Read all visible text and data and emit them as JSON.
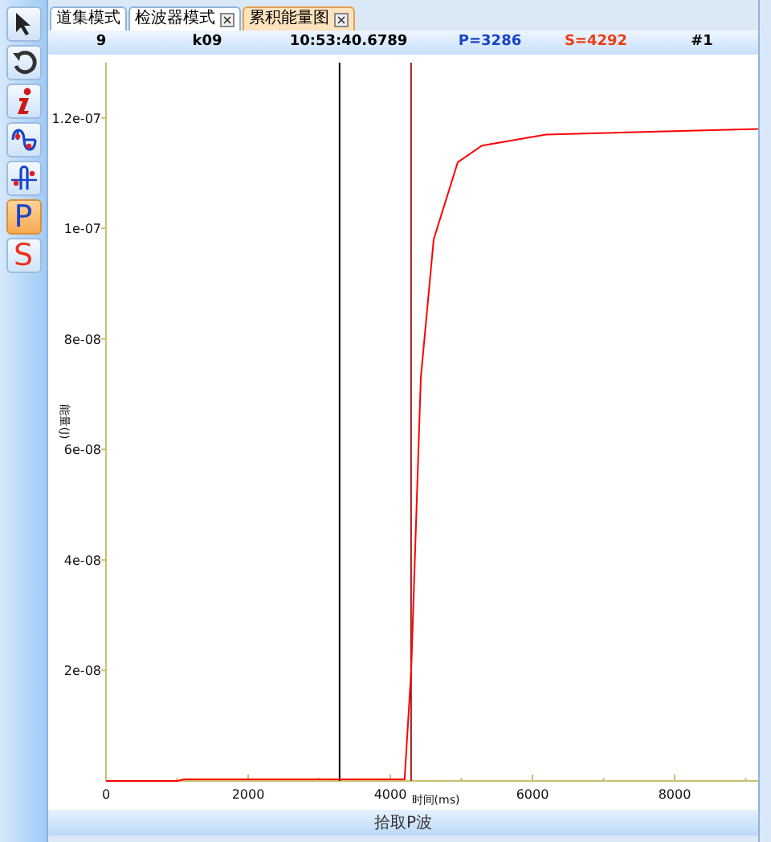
{
  "toolbar": [
    {
      "kind": "pointer",
      "selected": false
    },
    {
      "kind": "rotate",
      "selected": false
    },
    {
      "kind": "info",
      "selected": false
    },
    {
      "kind": "wave-a",
      "selected": false
    },
    {
      "kind": "wave-b",
      "selected": false
    },
    {
      "kind": "letter",
      "label": "P",
      "color": "#1a44c8",
      "selected": true
    },
    {
      "kind": "letter",
      "label": "S",
      "color": "#e8321e",
      "selected": false
    }
  ],
  "tabs": [
    {
      "label": "道集模式",
      "closable": false,
      "selected": false
    },
    {
      "label": "检波器模式",
      "closable": true,
      "selected": false
    },
    {
      "label": "累积能量图",
      "closable": true,
      "selected": true
    }
  ],
  "info_bar": [
    {
      "text": "9",
      "color": "#000000"
    },
    {
      "text": "k09",
      "color": "#000000"
    },
    {
      "text": "10:53:40.6789",
      "color": "#000000"
    },
    {
      "text": "P=3286",
      "color": "#1a44c8"
    },
    {
      "text": "S=4292",
      "color": "#f03c14"
    },
    {
      "text": "#1",
      "color": "#000000"
    }
  ],
  "chart": {
    "chart_data": {
      "type": "line",
      "xlabel": "时间(ms)",
      "ylabel": "能量(J)",
      "x": [
        0,
        1000,
        1100,
        3300,
        4100,
        4200,
        4294,
        4430,
        4610,
        4950,
        5290,
        6190,
        9175
      ],
      "series": [
        {
          "color": "#ff0000",
          "values": [
            0,
            0,
            0,
            0,
            0,
            0,
            2e-08,
            7.3e-08,
            9.8e-08,
            1.12e-07,
            1.15e-07,
            1.17e-07,
            1.18e-07
          ]
        }
      ],
      "xlim": [
        0,
        9175
      ],
      "ylim": [
        0,
        1.3e-07
      ],
      "xticks": [
        0,
        2000,
        4000,
        6000,
        8000
      ],
      "yticks": [
        {
          "value": 2e-08,
          "label": "2e-08"
        },
        {
          "value": 4e-08,
          "label": "4e-08"
        },
        {
          "value": 6e-08,
          "label": "6e-08"
        },
        {
          "value": 8e-08,
          "label": "8e-08"
        },
        {
          "value": 1e-07,
          "label": "1e-07"
        },
        {
          "value": 1.2e-07,
          "label": "1.2e-07"
        }
      ],
      "ref_lines": [
        {
          "axis": "x",
          "value": 3286,
          "color": "#000000"
        },
        {
          "axis": "x",
          "value": 4292,
          "color": "#a01818"
        }
      ]
    }
  },
  "status_bar": {
    "text": "拾取P波"
  }
}
